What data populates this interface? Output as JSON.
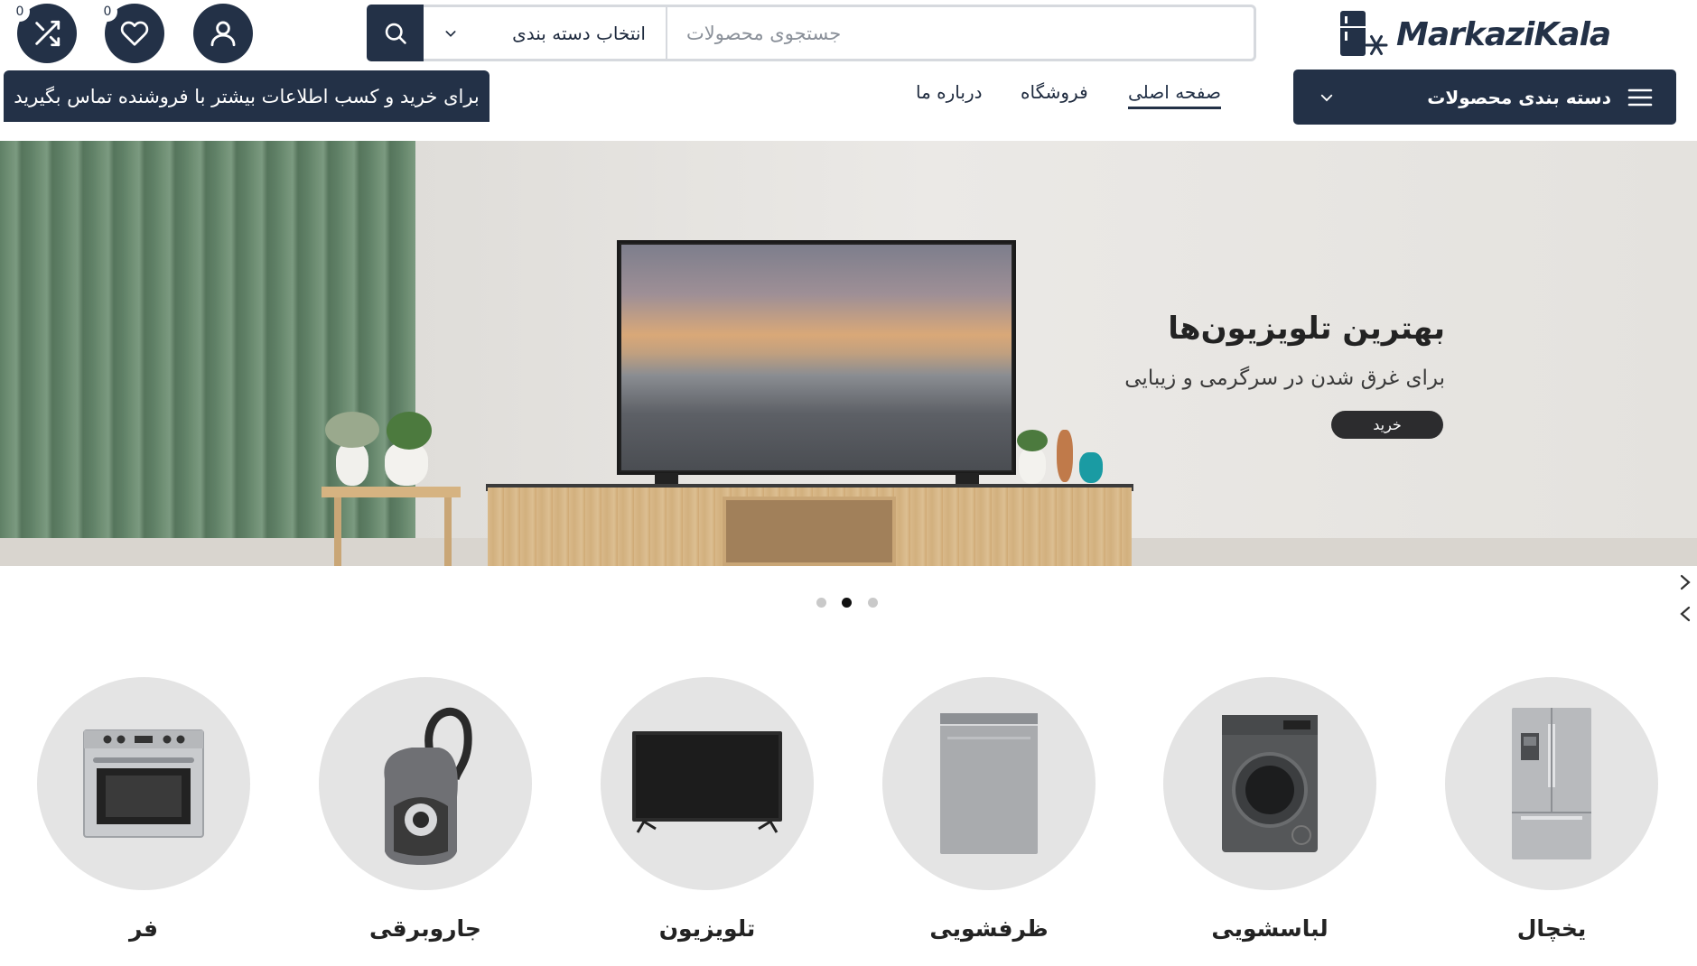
{
  "header": {
    "compare_count": "0",
    "wishlist_count": "0",
    "search": {
      "placeholder": "جستجوی محصولات",
      "category_select": "انتخاب دسته بندی"
    },
    "logo_text": "MarkaziKala",
    "contact_notice": "برای خرید و کسب اطلاعات بیشتر با فروشنده تماس بگیرید",
    "nav": [
      {
        "label": "صفحه اصلی",
        "active": true
      },
      {
        "label": "فروشگاه",
        "active": false
      },
      {
        "label": "درباره ما",
        "active": false
      }
    ],
    "category_menu_label": "دسته بندی محصولات",
    "colors": {
      "primary": "#233147"
    }
  },
  "hero": {
    "title": "بهترین تلویزیون‌ها",
    "subtitle": "برای غرق شدن در سرگرمی و زیبایی",
    "button_label": "خرید",
    "slides_count": 3,
    "active_slide": 2
  },
  "categories": [
    {
      "label": "فر",
      "icon": "oven-icon"
    },
    {
      "label": "جاروبرقی",
      "icon": "vacuum-icon"
    },
    {
      "label": "تلویزیون",
      "icon": "tv-icon"
    },
    {
      "label": "ظرفشویی",
      "icon": "dishwasher-icon"
    },
    {
      "label": "لباسشویی",
      "icon": "washing-machine-icon"
    },
    {
      "label": "یخچال",
      "icon": "refrigerator-icon"
    }
  ]
}
